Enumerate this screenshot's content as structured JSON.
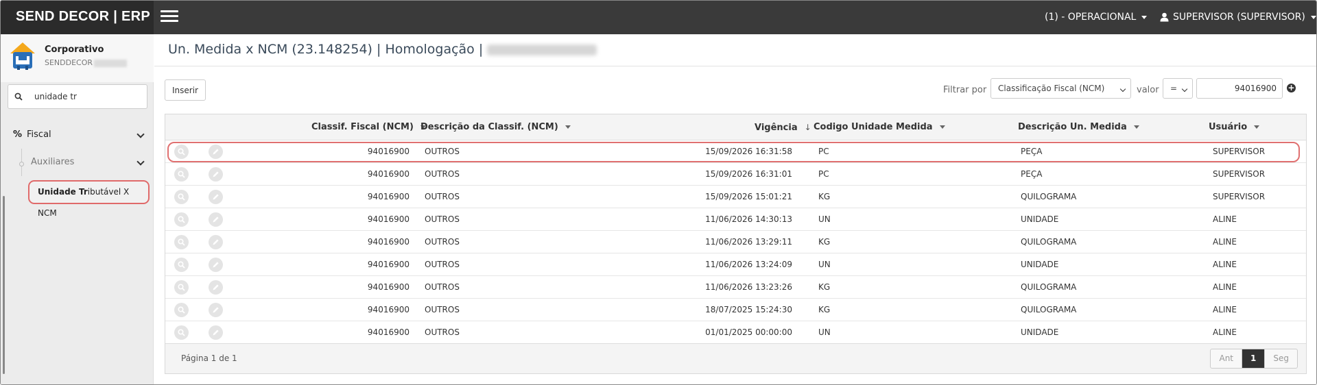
{
  "header": {
    "brand": "SEND DECOR | ERP",
    "context_menu": "(1) - OPERACIONAL",
    "user_menu": "SUPERVISOR (SUPERVISOR)"
  },
  "sidebar": {
    "company_name": "Corporativo",
    "company_code": "SENDDECOR",
    "search_value": "unidade tr",
    "menu_fiscal": "Fiscal",
    "menu_auxiliares": "Auxiliares",
    "active_item_bold": "Unidade Tr",
    "active_item_rest": "ibutável X NCM"
  },
  "main": {
    "title": "Un. Medida x NCM (23.148254) | Homologação |",
    "insert_button": "Inserir",
    "filter_label": "Filtrar por",
    "filter_field": "Classificação Fiscal (NCM)",
    "value_label": "valor",
    "operator": "=",
    "filter_value": "94016900"
  },
  "grid": {
    "columns": {
      "ncm": "Classif. Fiscal (NCM)",
      "desc": "Descrição da Classif. (NCM)",
      "vigencia": "Vigência",
      "cod_un": "Codigo Unidade Medida",
      "desc_un": "Descrição Un. Medida",
      "usuario": "Usuário"
    },
    "rows": [
      {
        "ncm": "94016900",
        "desc": "OUTROS",
        "vigencia": "15/09/2026 16:31:58",
        "cod": "PC",
        "un": "PEÇA",
        "user": "SUPERVISOR"
      },
      {
        "ncm": "94016900",
        "desc": "OUTROS",
        "vigencia": "15/09/2026 16:31:01",
        "cod": "PC",
        "un": "PEÇA",
        "user": "SUPERVISOR"
      },
      {
        "ncm": "94016900",
        "desc": "OUTROS",
        "vigencia": "15/09/2026 15:01:21",
        "cod": "KG",
        "un": "QUILOGRAMA",
        "user": "SUPERVISOR"
      },
      {
        "ncm": "94016900",
        "desc": "OUTROS",
        "vigencia": "11/06/2026 14:30:13",
        "cod": "UN",
        "un": "UNIDADE",
        "user": "ALINE"
      },
      {
        "ncm": "94016900",
        "desc": "OUTROS",
        "vigencia": "11/06/2026 13:29:11",
        "cod": "KG",
        "un": "QUILOGRAMA",
        "user": "ALINE"
      },
      {
        "ncm": "94016900",
        "desc": "OUTROS",
        "vigencia": "11/06/2026 13:24:09",
        "cod": "UN",
        "un": "UNIDADE",
        "user": "ALINE"
      },
      {
        "ncm": "94016900",
        "desc": "OUTROS",
        "vigencia": "11/06/2026 13:23:26",
        "cod": "KG",
        "un": "QUILOGRAMA",
        "user": "ALINE"
      },
      {
        "ncm": "94016900",
        "desc": "OUTROS",
        "vigencia": "18/07/2025 15:24:30",
        "cod": "KG",
        "un": "QUILOGRAMA",
        "user": "ALINE"
      },
      {
        "ncm": "94016900",
        "desc": "OUTROS",
        "vigencia": "01/01/2025 00:00:00",
        "cod": "UN",
        "un": "UNIDADE",
        "user": "ALINE"
      }
    ],
    "page_info": "Página 1 de 1",
    "pager": {
      "prev": "Ant",
      "current": "1",
      "next": "Seg"
    }
  }
}
